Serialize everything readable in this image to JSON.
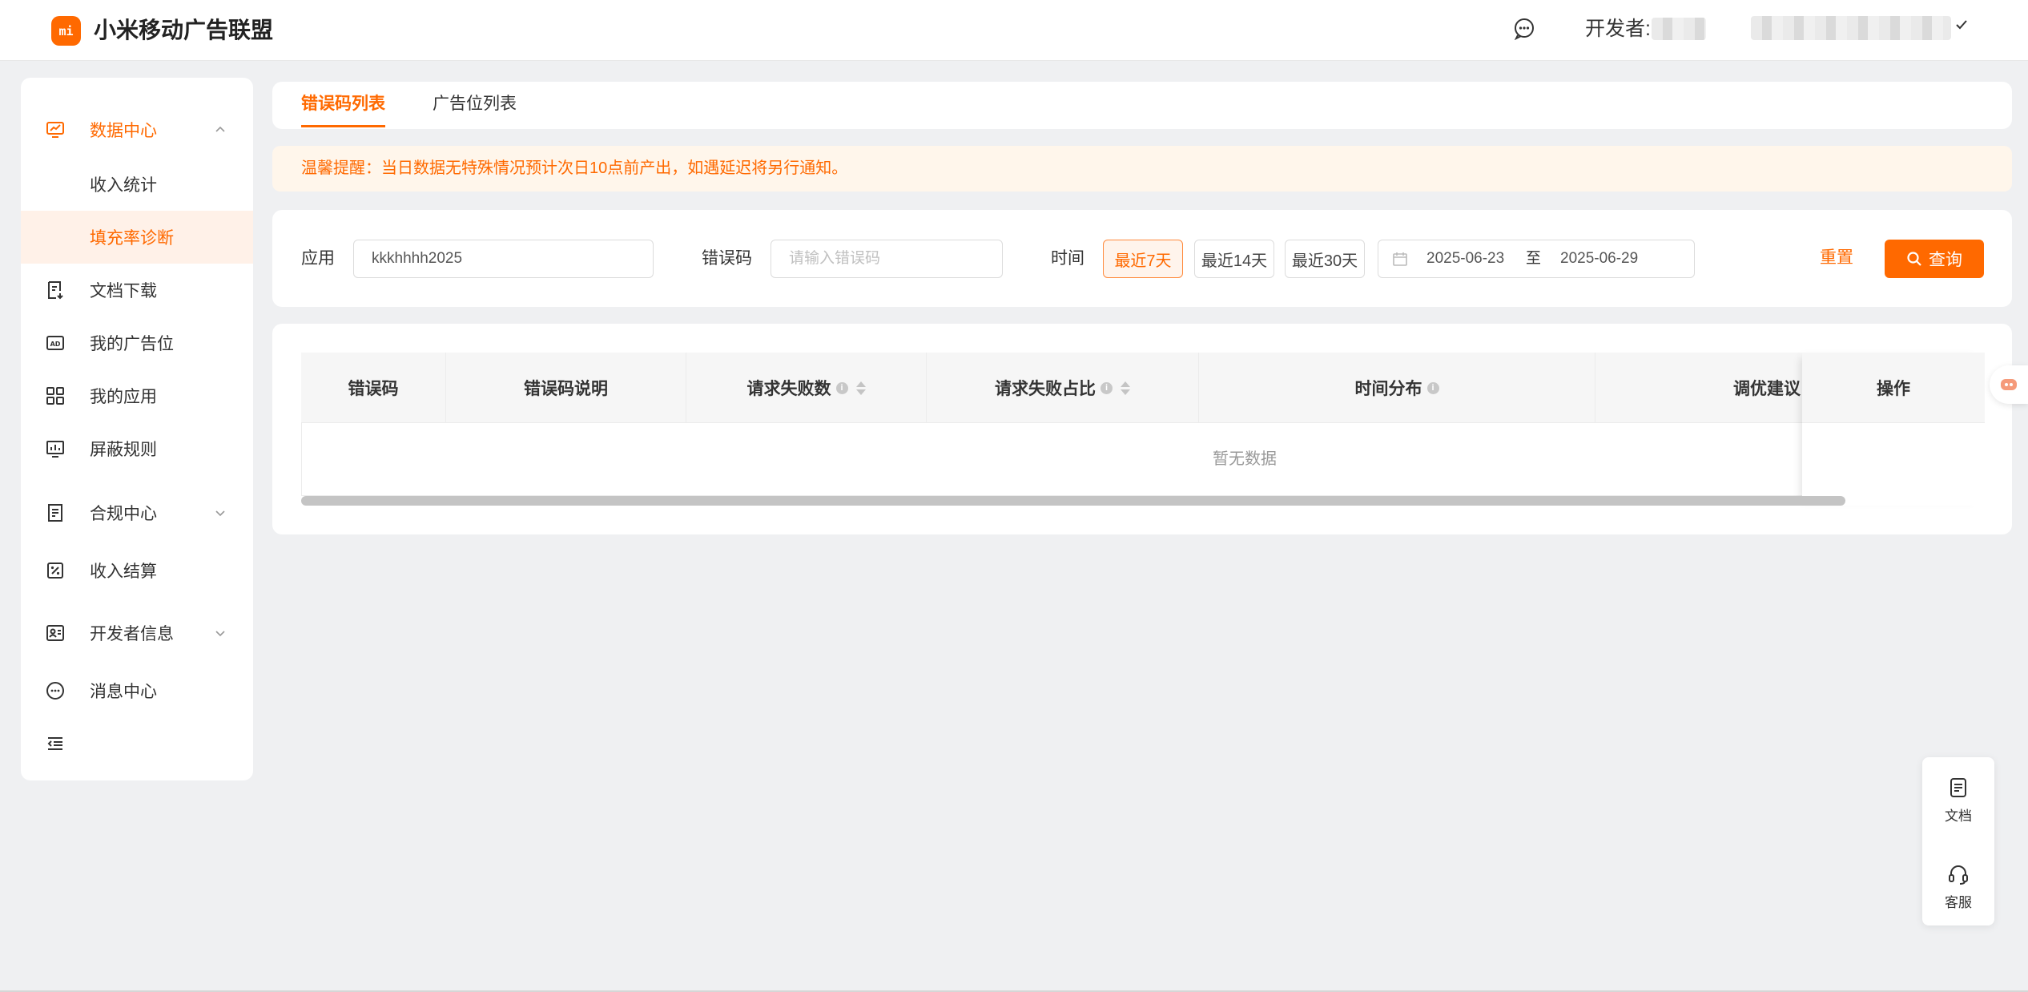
{
  "header": {
    "logo_text": "mi",
    "title": "小米移动广告联盟",
    "developer_label": "开发者:"
  },
  "sidebar": {
    "items": [
      {
        "label": "数据中心",
        "icon": "chart-monitor-icon"
      },
      {
        "label": "收入统计"
      },
      {
        "label": "填充率诊断"
      },
      {
        "label": "文档下载",
        "icon": "document-download-icon"
      },
      {
        "label": "我的广告位",
        "icon": "ad-slot-icon"
      },
      {
        "label": "我的应用",
        "icon": "apps-grid-icon"
      },
      {
        "label": "屏蔽规则",
        "icon": "shield-rule-icon"
      },
      {
        "label": "合规中心",
        "icon": "compliance-icon"
      },
      {
        "label": "收入结算",
        "icon": "settlement-icon"
      },
      {
        "label": "开发者信息",
        "icon": "developer-card-icon"
      },
      {
        "label": "消息中心",
        "icon": "message-icon"
      }
    ]
  },
  "tabs": [
    {
      "label": "错误码列表",
      "active": true
    },
    {
      "label": "广告位列表",
      "active": false
    }
  ],
  "notice": "温馨提醒：当日数据无特殊情况预计次日10点前产出，如遇延迟将另行通知。",
  "filters": {
    "app_label": "应用",
    "app_value": "kkkhhhh2025",
    "errcode_label": "错误码",
    "errcode_placeholder": "请输入错误码",
    "time_label": "时间",
    "time_options": [
      "最近7天",
      "最近14天",
      "最近30天"
    ],
    "start_date": "2025-06-23",
    "date_sep": "至",
    "end_date": "2025-06-29",
    "reset_label": "重置",
    "query_label": "查询"
  },
  "table": {
    "columns": [
      "错误码",
      "错误码说明",
      "请求失败数",
      "请求失败占比",
      "时间分布",
      "调优建议",
      "操作"
    ],
    "empty_text": "暂无数据"
  },
  "float_tools": [
    {
      "label": "文档",
      "icon": "doc-icon"
    },
    {
      "label": "客服",
      "icon": "headset-icon"
    }
  ],
  "colors": {
    "accent": "#ff6900",
    "notice_bg": "#fff6eb",
    "page_bg": "#eff0f2"
  }
}
